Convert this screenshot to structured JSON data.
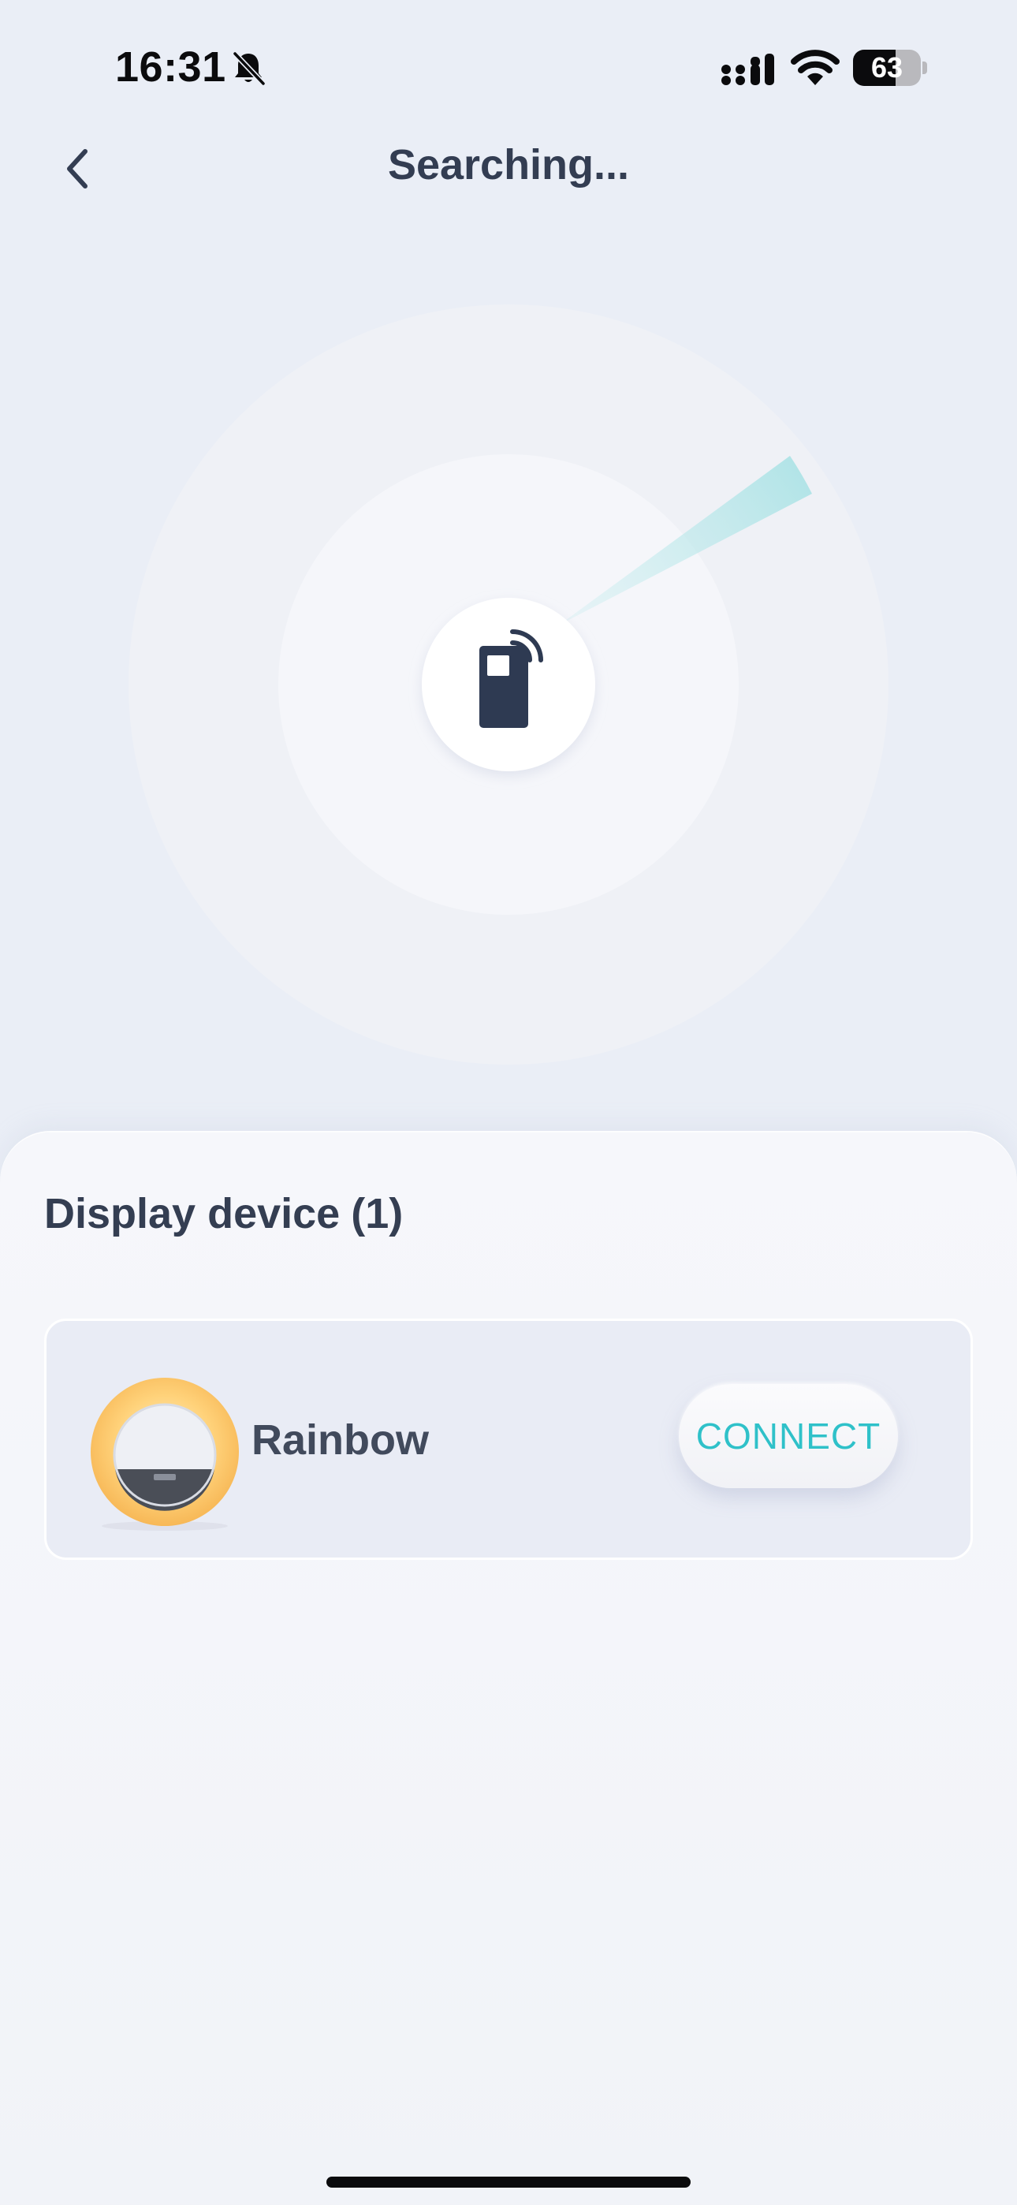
{
  "status_bar": {
    "time": "16:31",
    "silent_icon": "bell-slash-icon",
    "signal_icon": "cellular-signal-icon",
    "wifi_icon": "wifi-icon",
    "battery_level": "63",
    "battery_fraction": 0.63
  },
  "header": {
    "back_icon": "chevron-left-icon",
    "title": "Searching..."
  },
  "radar": {
    "center_icon": "walkie-talkie-device-icon",
    "sweep_color": "#b7e6e8"
  },
  "devices": {
    "heading_label": "Display device",
    "heading_count": "(1)",
    "items": [
      {
        "name": "Rainbow",
        "image": "rainbow-sunrise-lamp-image",
        "action_label": "CONNECT"
      }
    ]
  },
  "colors": {
    "background": "#eaeef6",
    "accent": "#2fc1c9",
    "title_text": "#333d52",
    "icon_dark": "#2e3a52"
  }
}
